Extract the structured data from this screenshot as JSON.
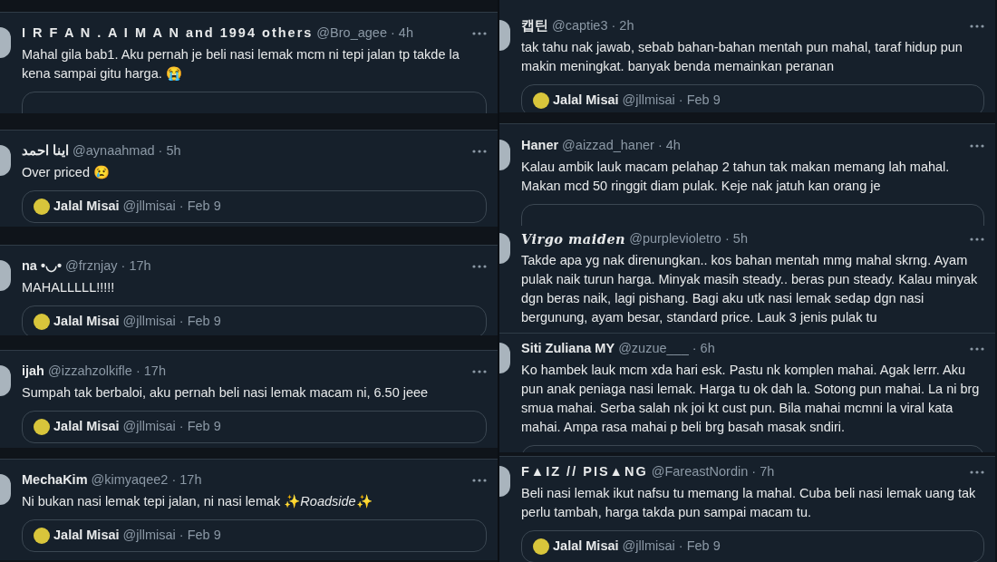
{
  "columns": [
    {
      "tweets": [
        {
          "name": "I R F A N . A I M A N and 1994 others",
          "kind": "spaced",
          "meta": "@Bro_agee · 4h",
          "text": "Mahal gila bab1. Aku pernah je beli nasi lemak mcm ni tepi jalan tp takde la kena sampai gitu harga. 😭",
          "quote_box": true
        },
        {
          "name": "اينا احمد",
          "kind": "plain",
          "meta": "@aynaahmad · 5h",
          "text": "Over priced 😢",
          "quote": {
            "name": "Jalal Misai",
            "meta": "@jllmisai · Feb 9"
          }
        },
        {
          "name": "na •◡•",
          "kind": "plain",
          "meta": "@frznjay · 17h",
          "text": "MAHALLLLL!!!!!",
          "quote": {
            "name": "Jalal Misai",
            "meta": "@jllmisai · Feb 9"
          }
        },
        {
          "name": "ijah",
          "kind": "plain",
          "meta": "@izzahzolkifle · 17h",
          "text": "Sumpah tak berbaloi, aku pernah beli nasi lemak macam ni, 6.50 jeee",
          "quote": {
            "name": "Jalal Misai",
            "meta": "@jllmisai · Feb 9"
          }
        },
        {
          "name": "MechaKim",
          "kind": "plain",
          "meta": "@kimyaqee2 · 17h",
          "text": "Ni bukan nasi lemak tepi jalan, ni nasi lemak ✨*Roadside*✨",
          "quote": {
            "name": "Jalal Misai",
            "meta": "@jllmisai · Feb 9"
          }
        }
      ]
    },
    {
      "tweets": [
        {
          "name": "캡틴",
          "kind": "plain",
          "meta": "@captie3 · 2h",
          "text": "tak tahu nak jawab, sebab bahan-bahan mentah pun mahal, taraf hidup pun makin meningkat. banyak benda memainkan peranan",
          "quote": {
            "name": "Jalal Misai",
            "meta": "@jllmisai · Feb 9"
          }
        },
        {
          "name": "Haner",
          "kind": "plain",
          "meta": "@aizzad_haner · 4h",
          "text": "Kalau ambik lauk macam pelahap 2 tahun tak makan memang lah mahal. Makan mcd 50 ringgit diam pulak. Keje nak jatuh kan orang je",
          "quote_box": true
        },
        {
          "name": "Virgo maiden",
          "kind": "script",
          "meta": "@purplevioletro · 5h",
          "text": "Takde apa yg nak direnungkan.. kos bahan mentah mmg mahal skrng. Ayam pulak naik turun harga. Minyak masih steady.. beras pun steady. Kalau minyak dgn beras naik, lagi pishang. Bagi aku utk nasi lemak sedap dgn nasi bergunung, ayam besar, standard price. Lauk 3 jenis pulak tu"
        },
        {
          "name": "Siti Zuliana MY",
          "kind": "plain",
          "meta": "@zuzue___ · 6h",
          "text": "Ko hambek lauk mcm xda hari esk. Pastu nk komplen mahai. Agak lerrr. Aku pun anak peniaga nasi lemak. Harga tu ok dah la. Sotong pun mahai. La ni brg smua mahai. Serba salah nk joi kt cust pun. Bila mahai mcmni la viral kata mahai. Ampa rasa mahai p beli brg basah masak sndiri.",
          "quote_box": true
        },
        {
          "name": "F▲IZ // PIS▲NG",
          "kind": "spaced",
          "meta": "@FareastNordin · 7h",
          "text": "Beli nasi lemak ikut nafsu tu memang la mahal. Cuba beli nasi lemak uang tak perlu tambah, harga takda pun sampai macam tu.",
          "quote": {
            "name": "Jalal Misai",
            "meta": "@jllmisai · Feb 9"
          }
        }
      ]
    }
  ]
}
